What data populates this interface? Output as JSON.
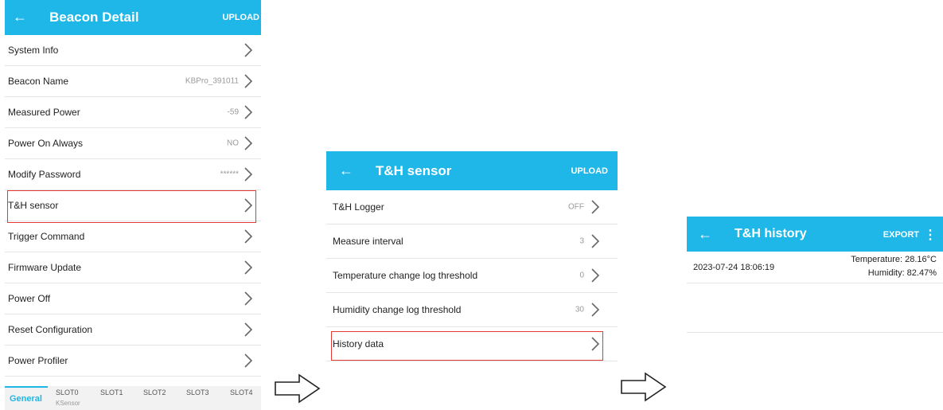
{
  "screen1": {
    "back_icon": "arrow-left-icon",
    "title": "Beacon Detail",
    "action": "UPLOAD",
    "rows": [
      {
        "label": "System Info",
        "value": ""
      },
      {
        "label": "Beacon Name",
        "value": "KBPro_391011"
      },
      {
        "label": "Measured Power",
        "value": "-59"
      },
      {
        "label": "Power On Always",
        "value": "NO"
      },
      {
        "label": "Modify Password",
        "value": "******"
      },
      {
        "label": "T&H sensor",
        "value": ""
      },
      {
        "label": "Trigger Command",
        "value": ""
      },
      {
        "label": "Firmware Update",
        "value": ""
      },
      {
        "label": "Power Off",
        "value": ""
      },
      {
        "label": "Reset Configuration",
        "value": ""
      },
      {
        "label": "Power Profiler",
        "value": ""
      }
    ],
    "tabs": [
      "General",
      "SLOT0",
      "SLOT1",
      "SLOT2",
      "SLOT3",
      "SLOT4"
    ],
    "tab_sub": "KSensor"
  },
  "screen2": {
    "back_icon": "arrow-left-icon",
    "title": "T&H sensor",
    "action": "UPLOAD",
    "rows": [
      {
        "label": "T&H Logger",
        "value": "OFF"
      },
      {
        "label": "Measure interval",
        "value": "3"
      },
      {
        "label": "Temperature change log threshold",
        "value": "0"
      },
      {
        "label": "Humidity change log threshold",
        "value": "30"
      },
      {
        "label": "History data",
        "value": ""
      }
    ]
  },
  "screen3": {
    "back_icon": "arrow-left-icon",
    "title": "T&H history",
    "action": "EXPORT",
    "menu_icon": "more-vert-icon",
    "record": {
      "timestamp": "2023-07-24 18:06:19",
      "temperature": "Temperature: 28.16°C",
      "humidity": "Humidity: 82.47%"
    }
  },
  "colors": {
    "accent": "#1fb6e8",
    "highlight": "#e53935"
  }
}
